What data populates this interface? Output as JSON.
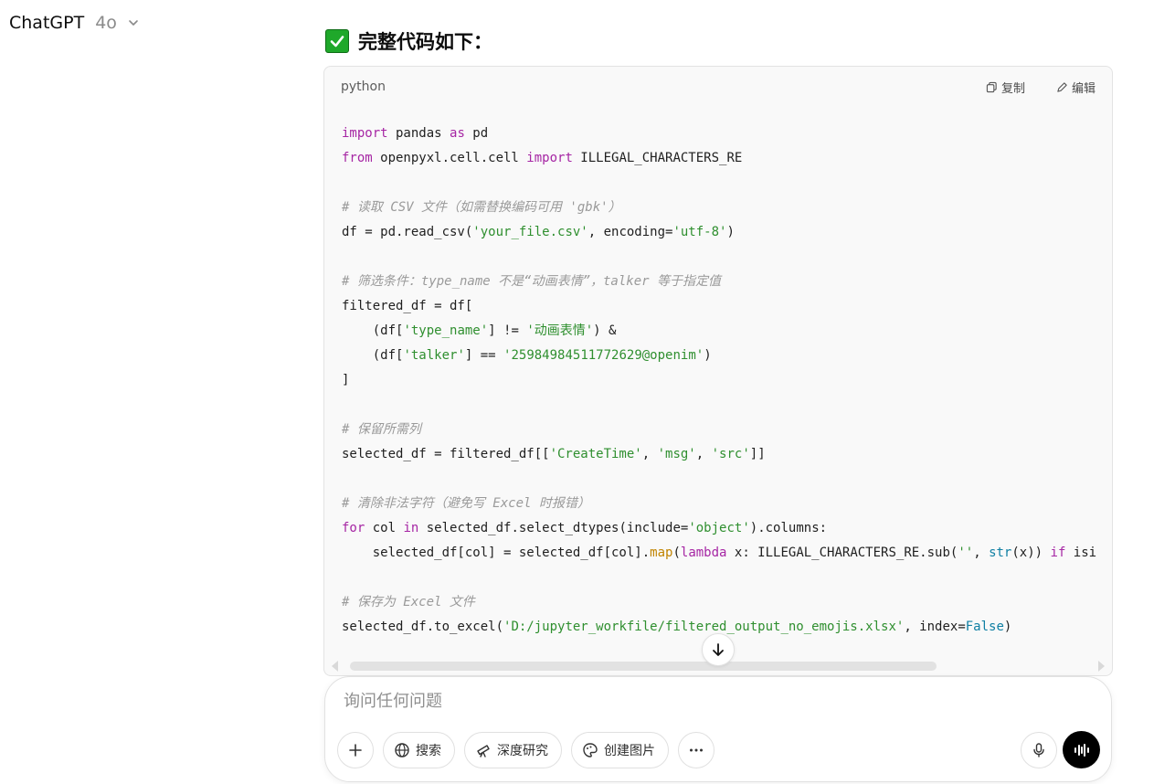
{
  "header": {
    "model_name": "ChatGPT",
    "model_version": "4o"
  },
  "message": {
    "heading": "完整代码如下："
  },
  "code_block": {
    "language": "python",
    "copy_label": "复制",
    "edit_label": "编辑",
    "lines": [
      "import pandas as pd",
      "from openpyxl.cell.cell import ILLEGAL_CHARACTERS_RE",
      "",
      "# 读取 CSV 文件（如需替换编码可用 'gbk'）",
      "df = pd.read_csv('your_file.csv', encoding='utf-8')",
      "",
      "# 筛选条件：type_name 不是“动画表情”，talker 等于指定值",
      "filtered_df = df[",
      "    (df['type_name'] != '动画表情') &",
      "    (df['talker'] == '25984984511772629@openim')",
      "]",
      "",
      "# 保留所需列",
      "selected_df = filtered_df[['CreateTime', 'msg', 'src']]",
      "",
      "# 清除非法字符（避免写 Excel 时报错）",
      "for col in selected_df.select_dtypes(include='object').columns:",
      "    selected_df[col] = selected_df[col].map(lambda x: ILLEGAL_CHARACTERS_RE.sub('', str(x)) if isi",
      "",
      "# 保存为 Excel 文件",
      "selected_df.to_excel('D:/jupyter_workfile/filtered_output_no_emojis.xlsx', index=False)"
    ]
  },
  "composer": {
    "placeholder": "询问任何问题",
    "search_label": "搜索",
    "deep_research_label": "深度研究",
    "create_image_label": "创建图片"
  },
  "icons": {
    "heading": "check-mark-button-icon",
    "copy": "copy-icon",
    "edit": "pencil-icon",
    "scroll": "arrow-down-icon",
    "add": "plus-icon",
    "search": "globe-icon",
    "deep_research": "telescope-icon",
    "create_image": "palette-icon",
    "more": "ellipsis-icon",
    "mic": "microphone-icon",
    "voice": "voice-waveform-icon"
  },
  "colors": {
    "keyword": "#a626a4",
    "string": "#2f8f2f",
    "comment": "#9a9a9a",
    "function": "#c18401",
    "builtin": "#0f7fa3"
  }
}
